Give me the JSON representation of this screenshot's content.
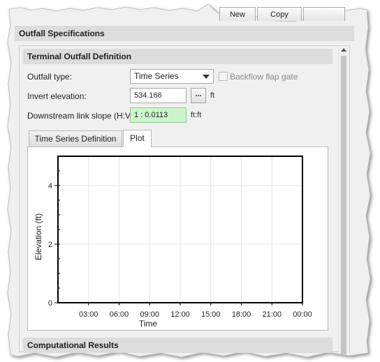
{
  "toolbar": {
    "new_label": "New",
    "copy_label": "Copy"
  },
  "outfall_specifications": {
    "title": "Outfall Specifications"
  },
  "terminal_outfall": {
    "title": "Terminal Outfall Definition",
    "outfall_type_label": "Outfall type:",
    "outfall_type_value": "Time Series",
    "backflow_label": "Backflow flap gate",
    "backflow_checked": false,
    "invert_label": "Invert elevation:",
    "invert_value": "534.166",
    "invert_unit": "ft",
    "ellipsis_label": "...",
    "slope_label": "Downstream link slope (H:V):",
    "slope_value": "1 : 0.0113",
    "slope_unit": "ft:ft"
  },
  "tabs": [
    {
      "label": "Time Series Definition",
      "active": false
    },
    {
      "label": "Plot",
      "active": true
    }
  ],
  "chart_data": {
    "type": "line",
    "title": "",
    "xlabel": "Time",
    "ylabel": "Elevation (ft)",
    "x_tick_labels": [
      "03:00",
      "06:00",
      "09:00",
      "12:00",
      "15:00",
      "18:00",
      "21:00",
      "00:00"
    ],
    "y_tick_labels": [
      "0",
      "2",
      "4"
    ],
    "ylim": [
      0,
      5
    ],
    "grid": true,
    "series": []
  },
  "computational_results": {
    "title": "Computational Results"
  },
  "colors": {
    "section_header_bg": "#dcdcdc",
    "slope_field_bg": "#ccf5cc",
    "plot_frame": "#000000"
  }
}
